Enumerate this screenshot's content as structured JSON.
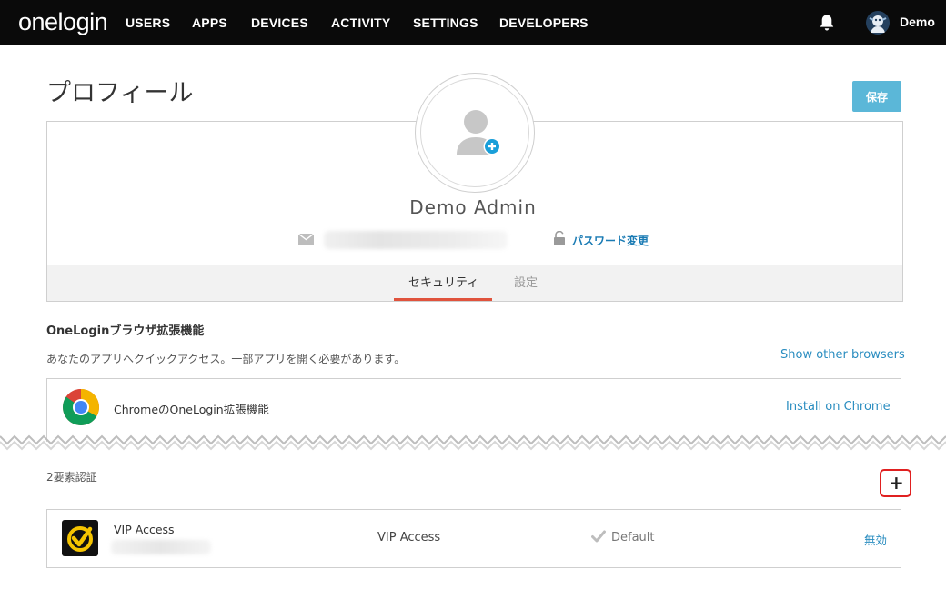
{
  "nav": {
    "logo": "onelogin",
    "items": [
      "USERS",
      "APPS",
      "DEVICES",
      "ACTIVITY",
      "SETTINGS",
      "DEVELOPERS"
    ],
    "user_name": "Demo",
    "icons": {
      "notifications": "bell-icon",
      "avatar": "user-avatar"
    }
  },
  "page": {
    "title": "プロフィール",
    "save_label": "保存"
  },
  "profile": {
    "name": "Demo Admin",
    "password_link": "パスワード変更",
    "tabs": [
      {
        "label": "セキュリティ",
        "active": true
      },
      {
        "label": "設定",
        "active": false
      }
    ]
  },
  "browser_extension": {
    "title": "OneLoginブラウザ拡張機能",
    "description": "あなたのアプリへクイックアクセス。一部アプリを開く必要があります。",
    "other_browsers_link": "Show other browsers",
    "chrome": {
      "label": "ChromeのOneLogin拡張機能",
      "install_link": "Install on Chrome"
    }
  },
  "two_factor": {
    "title": "2要素認証",
    "add_button": "+",
    "factors": [
      {
        "name": "VIP Access",
        "type": "VIP Access",
        "default_label": "Default",
        "disable_link": "無効"
      }
    ]
  },
  "colors": {
    "nav_bg": "#0a0a0a",
    "accent": "#5bb7d8",
    "link": "#2a8dc0",
    "tab_active": "#e0533d",
    "highlight": "#e02020"
  }
}
